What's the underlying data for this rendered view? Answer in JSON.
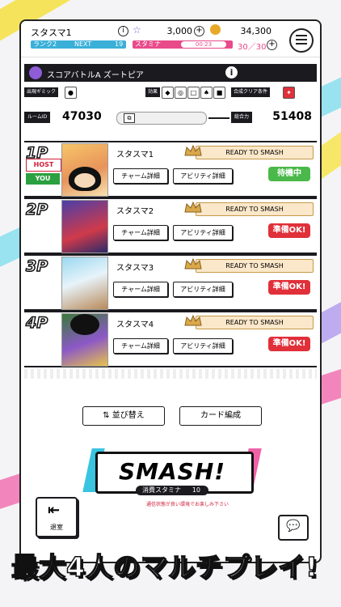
{
  "header": {
    "player_name": "スタスマ1",
    "coins": "3,000",
    "gems": "34,300",
    "rank_label": "ランク2",
    "next_label": "NEXT",
    "next_value": "19",
    "stamina_label": "スタミナ",
    "stamina_timer": "00:23",
    "stamina_value": "30／30"
  },
  "battle": {
    "title": "スコアバトルA ズートピア",
    "gimmick_label": "出現ギミック",
    "effect_label": "効果",
    "clear_label": "合成クリア条件"
  },
  "room": {
    "id_label": "ルームID",
    "id": "47030",
    "power_label": "総合力",
    "power": "51408"
  },
  "players": [
    {
      "num": "1P",
      "name": "スタスマ1",
      "ready": "READY TO SMASH",
      "charm": "チャーム詳細",
      "ability": "アビリティ詳細",
      "status": "待機中",
      "host": "HOST",
      "you": "YOU"
    },
    {
      "num": "2P",
      "name": "スタスマ2",
      "ready": "READY TO SMASH",
      "charm": "チャーム詳細",
      "ability": "アビリティ詳細",
      "status": "準備OK!"
    },
    {
      "num": "3P",
      "name": "スタスマ3",
      "ready": "READY TO SMASH",
      "charm": "チャーム詳細",
      "ability": "アビリティ詳細",
      "status": "準備OK!"
    },
    {
      "num": "4P",
      "name": "スタスマ4",
      "ready": "READY TO SMASH",
      "charm": "チャーム詳細",
      "ability": "アビリティ詳細",
      "status": "準備OK!"
    }
  ],
  "actions": {
    "sort": "⇅ 並び替え",
    "deck": "カード編成",
    "smash": "SMASH!",
    "stamina_cost_label": "消費スタミナ",
    "stamina_cost": "10",
    "note": "通信状態が良い環境でお楽しみ下さい",
    "leave": "退室"
  },
  "banner": "最大4人のマルチプレイ!",
  "colors": {
    "accent_pink": "#e84a8a",
    "accent_blue": "#3ab0d8",
    "ready_green": "#2aa040",
    "status_red": "#e0303a",
    "dark": "#1b1b1f"
  }
}
